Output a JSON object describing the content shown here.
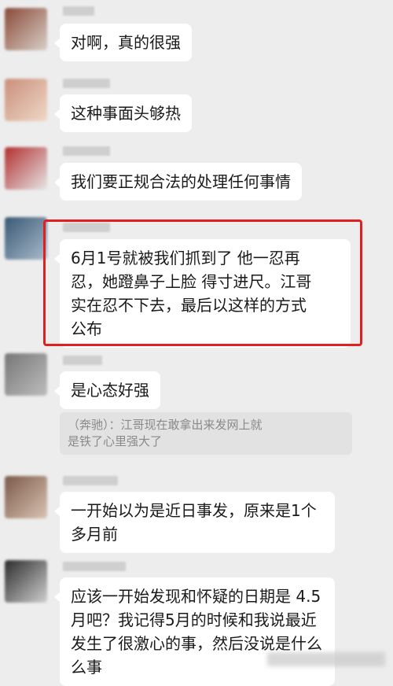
{
  "messages": [
    {
      "text": "对啊，真的很强",
      "avatar_colors": [
        "#8b4a3a",
        "#d8cfc6"
      ]
    },
    {
      "text": "这种事面头够热",
      "avatar_colors": [
        "#c98f7a",
        "#f0d8c8"
      ]
    },
    {
      "text": "我们要正规合法的处理任何事情",
      "avatar_colors": [
        "#b23030",
        "#e6e6e6"
      ]
    },
    {
      "text": "6月1号就被我们抓到了 他一忍再\n忍，她蹬鼻子上脸 得寸进尺。江哥\n实在忍不下去，最后以这样的方式\n公布",
      "avatar_colors": [
        "#3a5874",
        "#a9bccc"
      ]
    },
    {
      "text": "是心态好强",
      "avatar_colors": [
        "#777777",
        "#bdbdbd"
      ],
      "quote": "（奔驰）：江哥现在敢拿出来发网上就\n是铁了心里强大了"
    },
    {
      "text": "一开始以为是近日事发，原来是1个\n多月前",
      "avatar_colors": [
        "#7b5a4a",
        "#d9c3b3"
      ]
    },
    {
      "text": "应该一开始发现和怀疑的日期是 4.5\n月吧？我记得5月的时候和我说最近\n发生了很激心的事，然后没说是什么\n么事",
      "avatar_colors": [
        "#2c2c2c",
        "#cfcfcf"
      ]
    }
  ],
  "colors": {
    "background": "#ededed",
    "bubble": "#ffffff",
    "highlight_border": "#e02020"
  }
}
